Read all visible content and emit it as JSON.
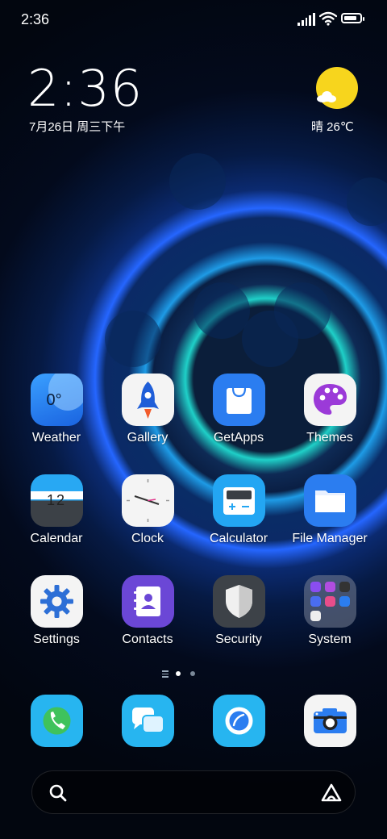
{
  "status_bar": {
    "time": "2:36",
    "battery_level": 0.85
  },
  "lock_widget": {
    "time": "2:36",
    "date": "7月26日 周三下午",
    "weather": "晴 26℃"
  },
  "apps": [
    {
      "label": "Weather",
      "icon": "weather-icon",
      "icon_text": "0°"
    },
    {
      "label": "Gallery",
      "icon": "rocket-icon"
    },
    {
      "label": "GetApps",
      "icon": "shopping-bag-icon"
    },
    {
      "label": "Themes",
      "icon": "palette-icon"
    },
    {
      "label": "Calendar",
      "icon": "calendar-icon",
      "icon_text": "12"
    },
    {
      "label": "Clock",
      "icon": "clock-icon"
    },
    {
      "label": "Calculator",
      "icon": "calculator-icon"
    },
    {
      "label": "File Manager",
      "icon": "folder-icon"
    },
    {
      "label": "Settings",
      "icon": "gear-icon"
    },
    {
      "label": "Contacts",
      "icon": "contacts-icon"
    },
    {
      "label": "Security",
      "icon": "shield-icon"
    },
    {
      "label": "System",
      "icon": "folder-grid-icon"
    }
  ],
  "page_indicator": {
    "pages": 2,
    "current": 1
  },
  "dock": [
    {
      "icon": "phone-icon"
    },
    {
      "icon": "messages-icon"
    },
    {
      "icon": "browser-icon"
    },
    {
      "icon": "camera-icon"
    }
  ],
  "search_bar": {
    "left_icon": "search-icon",
    "right_icon": "assistant-icon"
  },
  "colors": {
    "accent": "#2a86f0",
    "sun": "#f7d51d"
  }
}
